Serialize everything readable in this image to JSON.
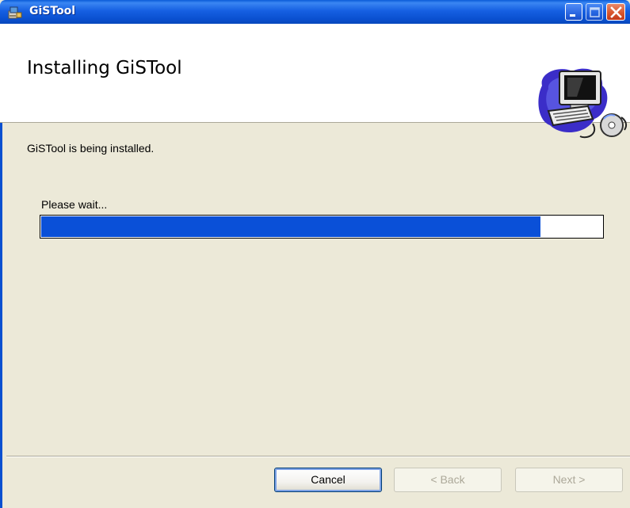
{
  "window": {
    "title": "GiSTool",
    "controls": [
      "minimize-icon",
      "maximize-icon",
      "close-icon"
    ]
  },
  "header": {
    "title": "Installing GiSTool",
    "graphic": "computer-install-icon"
  },
  "body": {
    "status": "GiSTool is being installed.",
    "wait_label": "Please wait...",
    "progress_fraction": 0.89
  },
  "footer": {
    "cancel_label": "Cancel",
    "back_label": "< Back",
    "next_label": "Next >"
  },
  "colors": {
    "titlebar": "#0a5bd8",
    "progress_fill": "#0a50d8",
    "dialog_bg": "#ece9d8"
  }
}
